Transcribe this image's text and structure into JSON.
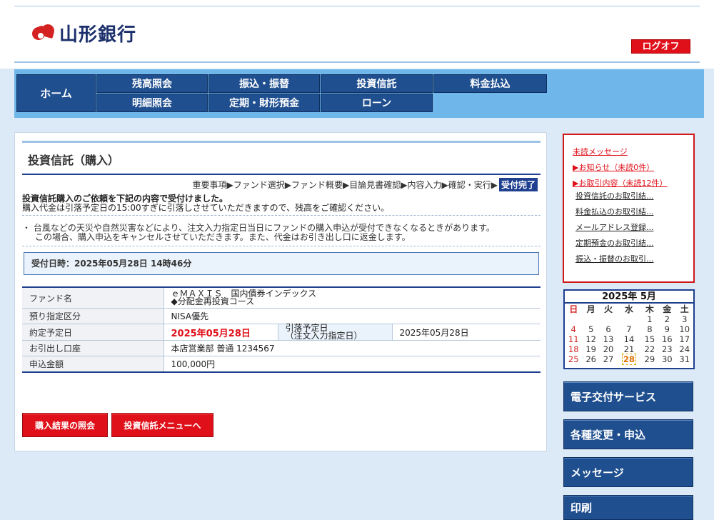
{
  "brand": {
    "name": "山形銀行"
  },
  "header": {
    "logoff_label": "ログオフ"
  },
  "nav": {
    "home": "ホーム",
    "row1": [
      "残高照会",
      "振込・振替",
      "投資信託",
      "料金払込"
    ],
    "row2": [
      "明細照会",
      "定期・財形預金",
      "ローン"
    ]
  },
  "page": {
    "title": "投資信託（購入）",
    "steps": [
      "重要事項",
      "ファンド選択",
      "ファンド概要",
      "目論見書確認",
      "内容入力",
      "確認・実行"
    ],
    "active_step": "受付完了",
    "message_bold": "投資信託購入のご依頼を下記の内容で受付けました。",
    "message_normal": "購入代金は引落予定日の15:00すぎに引落しさせていただきますので、残高をご確認ください。",
    "note_line1": "・ 台風などの天災や自然災害などにより、注文入力指定日当日にファンドの購入申込が受付できなくなるときがあります。",
    "note_line2": "この場合、購入申込をキャンセルさせていただきます。また、代金はお引き出し口に返金します。",
    "reception": "受付日時：2025年05月28日 14時46分"
  },
  "details": {
    "fund_label": "ファンド名",
    "fund_line1": "ｅＭＡＸＩＳ　国内債券インデックス",
    "fund_line2": "◆分配金再投資コース",
    "deposit_label": "預り指定区分",
    "deposit_value": "NISA優先",
    "contract_label": "約定予定日",
    "contract_value": "2025年05月28日",
    "debit_label_line1": "引落予定日",
    "debit_label_line2": "（注文入力指定日）",
    "debit_value": "2025年05月28日",
    "account_label": "お引出し口座",
    "account_value": "本店営業部 普通 1234567",
    "amount_label": "申込金額",
    "amount_value": "100,000円"
  },
  "buttons": {
    "result": "購入結果の照会",
    "menu": "投資信託メニューへ"
  },
  "notices": {
    "unread": "未読メッセージ",
    "news": "▶お知らせ（未読0件）",
    "transactions": "▶お取引内容（未読12件）",
    "links": [
      "投資信託のお取引結...",
      "料金払込のお取引結...",
      "メールアドレス登録...",
      "定期預金のお取引結...",
      "振込・振替のお取引..."
    ]
  },
  "calendar": {
    "title": "2025年 5月",
    "weekdays": [
      "日",
      "月",
      "火",
      "水",
      "木",
      "金",
      "土"
    ],
    "weeks": [
      [
        "",
        "",
        "",
        "",
        "1",
        "2",
        "3"
      ],
      [
        "4",
        "5",
        "6",
        "7",
        "8",
        "9",
        "10"
      ],
      [
        "11",
        "12",
        "13",
        "14",
        "15",
        "16",
        "17"
      ],
      [
        "18",
        "19",
        "20",
        "21",
        "22",
        "23",
        "24"
      ],
      [
        "25",
        "26",
        "27",
        "28",
        "29",
        "30",
        "31"
      ]
    ],
    "today": "28"
  },
  "side_menu": [
    "電子交付サービス",
    "各種変更・申込",
    "メッセージ",
    "印刷"
  ],
  "colors": {
    "navy": "#1f4f8f",
    "red": "#e0101a",
    "nav_band": "#6fb7ea",
    "background": "#dce9f6"
  }
}
